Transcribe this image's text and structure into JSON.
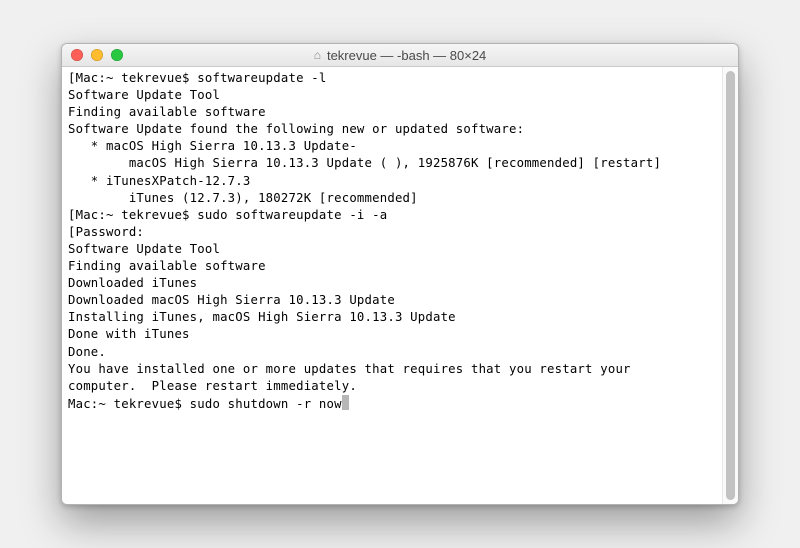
{
  "window": {
    "title": "tekrevue — -bash — 80×24",
    "home_icon": "⌂"
  },
  "traffic": {
    "close": "close",
    "minimize": "minimize",
    "zoom": "zoom"
  },
  "terminal": {
    "lines": [
      "[Mac:~ tekrevue$ softwareupdate -l",
      "Software Update Tool",
      "",
      "Finding available software",
      "Software Update found the following new or updated software:",
      "   * macOS High Sierra 10.13.3 Update-",
      "        macOS High Sierra 10.13.3 Update ( ), 1925876K [recommended] [restart]",
      "   * iTunesXPatch-12.7.3",
      "        iTunes (12.7.3), 180272K [recommended]",
      "[Mac:~ tekrevue$ sudo softwareupdate -i -a",
      "[Password:",
      "Software Update Tool",
      "",
      "Finding available software",
      "",
      "Downloaded iTunes",
      "Downloaded macOS High Sierra 10.13.3 Update",
      "Installing iTunes, macOS High Sierra 10.13.3 Update",
      "Done with iTunes",
      "Done.",
      "",
      "You have installed one or more updates that requires that you restart your",
      "computer.  Please restart immediately.",
      "Mac:~ tekrevue$ sudo shutdown -r now"
    ]
  }
}
